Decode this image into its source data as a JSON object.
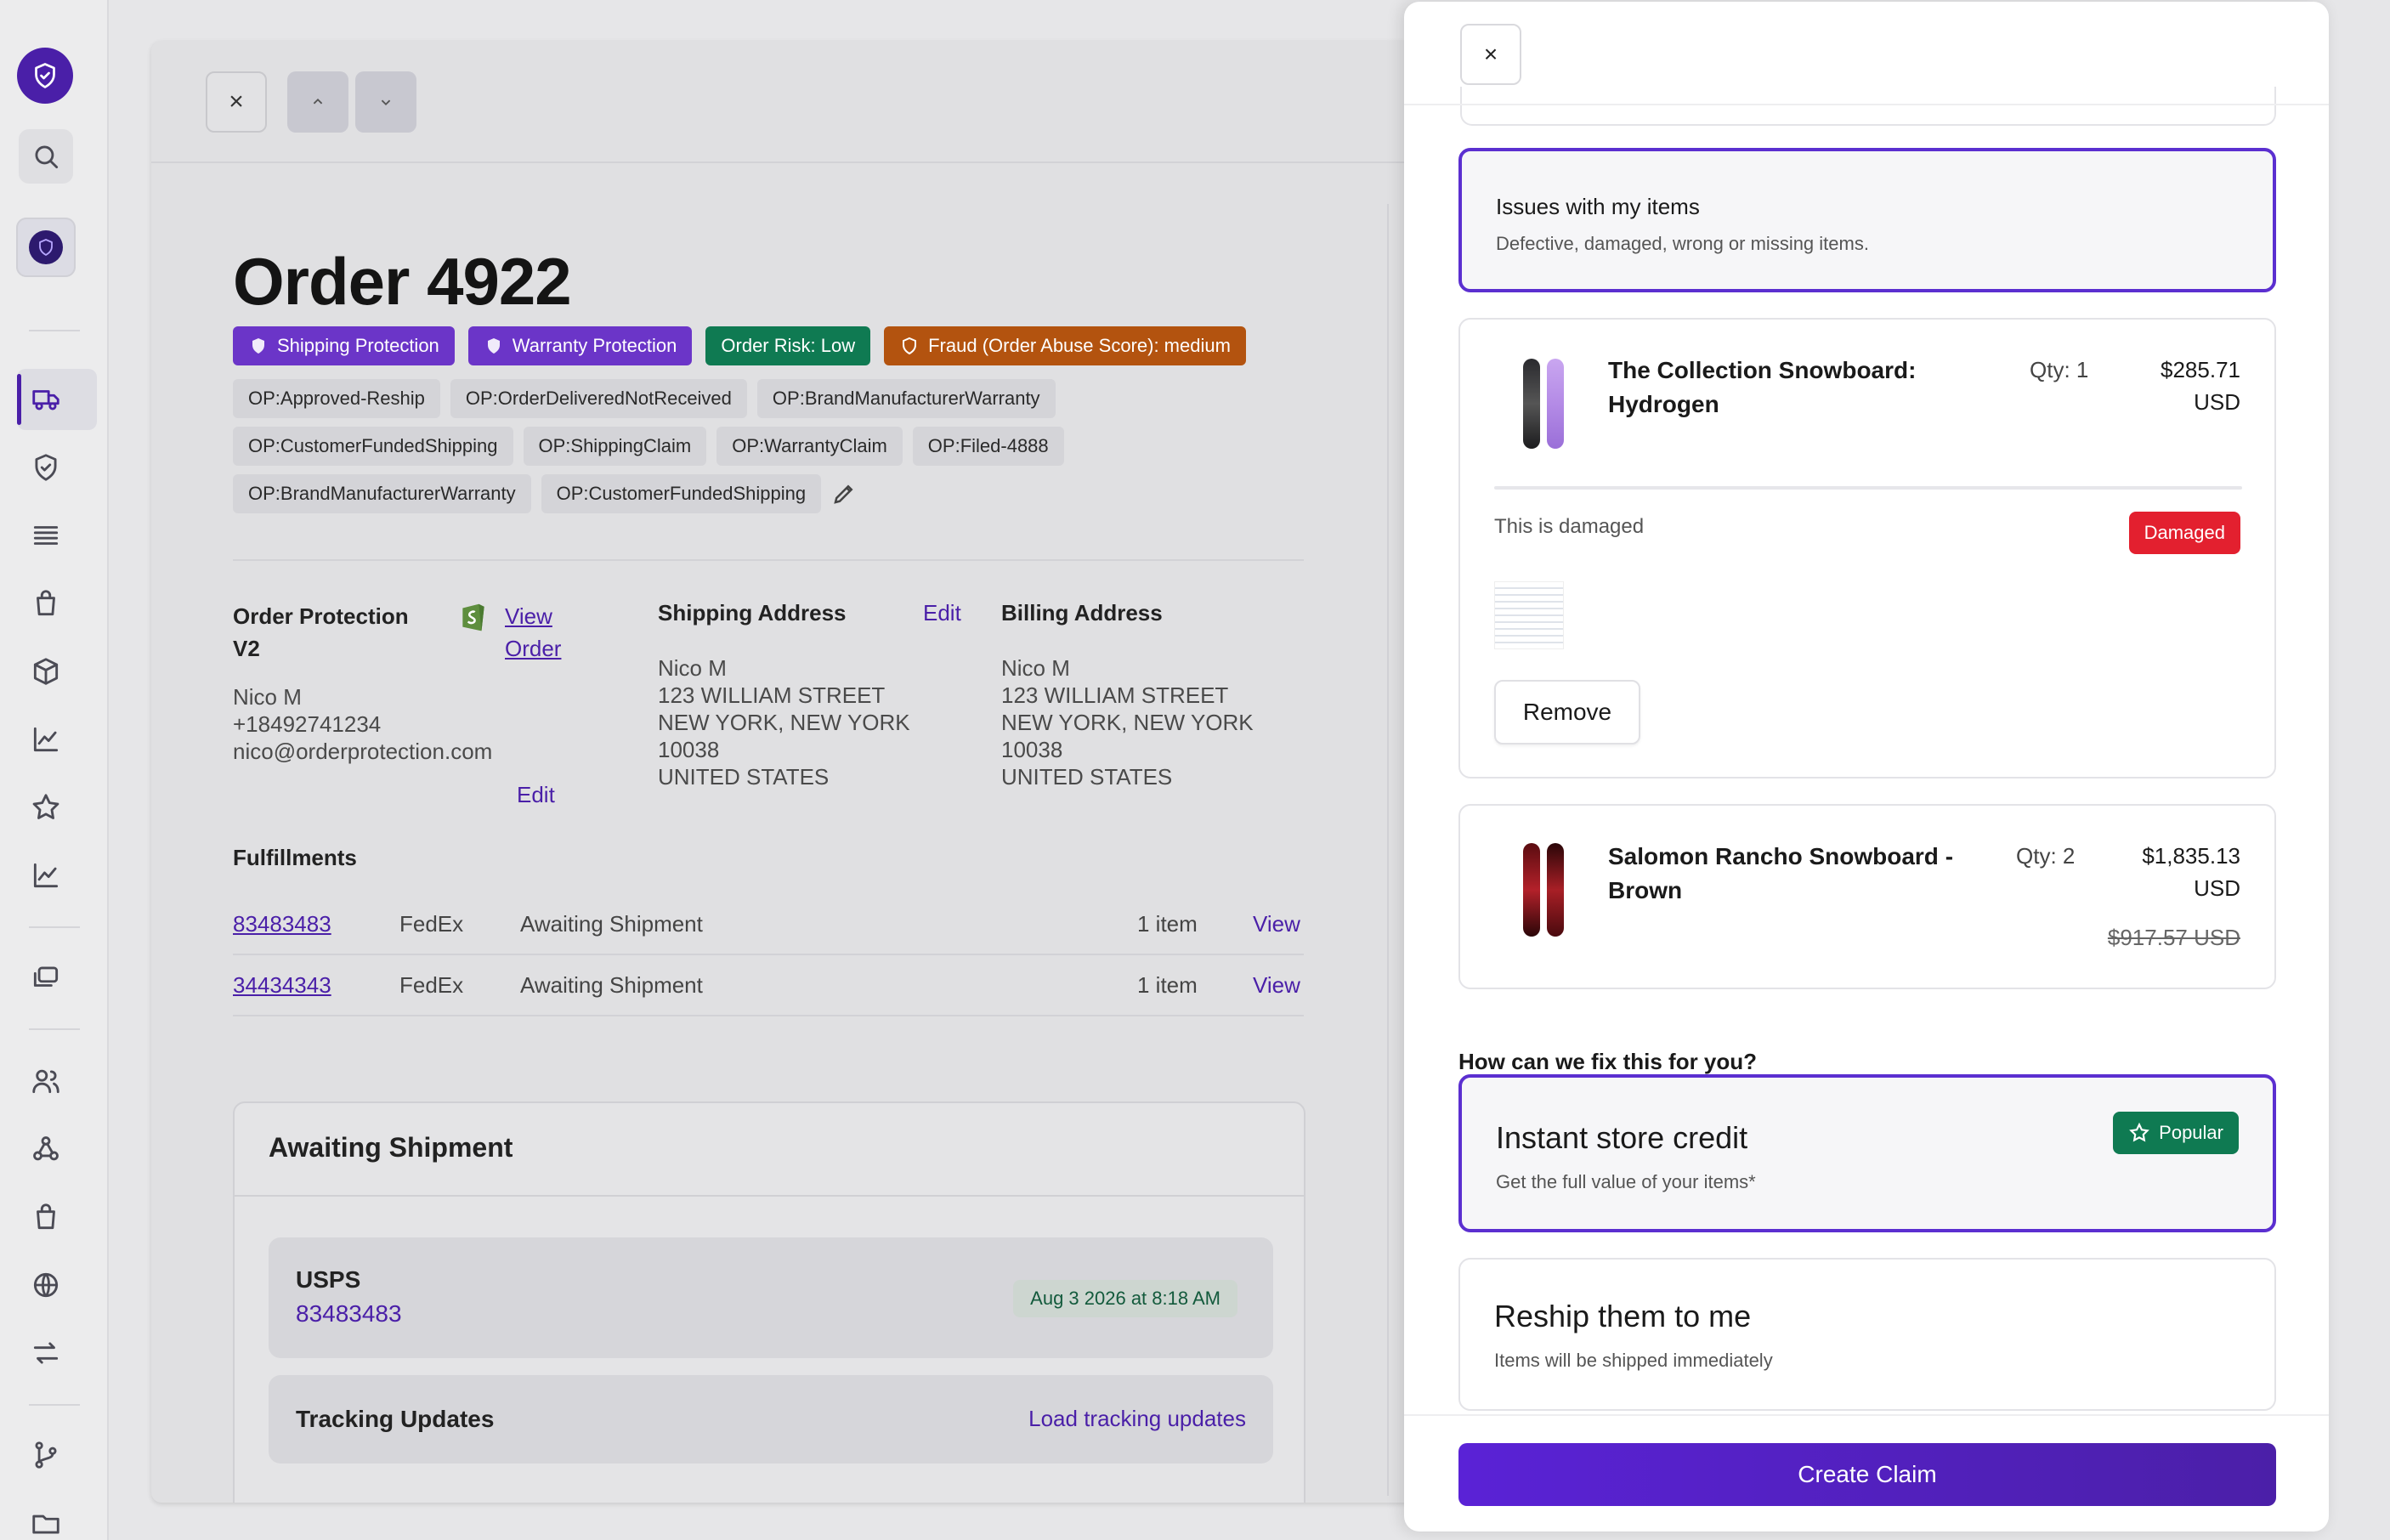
{
  "nav": {
    "icons": [
      "shield-logo-icon",
      "search-icon",
      "app-shield-icon",
      "truck-icon",
      "shield-icon",
      "list-icon",
      "bag-icon",
      "box-icon",
      "chart-icon",
      "star-icon",
      "chart-icon",
      "gallery-icon",
      "users-icon",
      "webhook-icon",
      "bag-icon",
      "globe-icon",
      "transfer-icon",
      "branch-icon",
      "folder-icon"
    ]
  },
  "order": {
    "title": "Order 4922",
    "badges": [
      {
        "label": "Shipping Protection",
        "color": "#6b35c8"
      },
      {
        "label": "Warranty Protection",
        "color": "#6b35c8"
      },
      {
        "label": "Order Risk: Low",
        "color": "#0f7a52"
      },
      {
        "label": "Fraud (Order Abuse Score): medium",
        "color": "#b3530f"
      }
    ],
    "tags": [
      "OP:Approved-Reship",
      "OP:OrderDeliveredNotReceived",
      "OP:BrandManufacturerWarranty",
      "OP:CustomerFundedShipping",
      "OP:ShippingClaim",
      "OP:WarrantyClaim",
      "OP:Filed-4888",
      "OP:BrandManufacturerWarranty",
      "OP:CustomerFundedShipping"
    ],
    "protection": {
      "title_line1": "Order Protection",
      "title_line2": "V2",
      "view_line1": "View",
      "view_line2": "Order",
      "name": "Nico M",
      "phone": "+18492741234",
      "email": "nico@orderprotection.com",
      "edit": "Edit"
    },
    "shipping": {
      "title": "Shipping Address",
      "edit": "Edit",
      "lines": [
        "Nico M",
        "123 WILLIAM STREET",
        "NEW YORK, NEW YORK",
        "10038",
        "UNITED STATES"
      ]
    },
    "billing": {
      "title": "Billing Address",
      "lines": [
        "Nico M",
        "123 WILLIAM STREET",
        "NEW YORK, NEW YORK",
        "10038",
        "UNITED STATES"
      ]
    },
    "fulfillments": {
      "title": "Fulfillments",
      "rows": [
        {
          "id": "83483483",
          "carrier": "FedEx",
          "status": "Awaiting Shipment",
          "count": "1 item",
          "action": "View"
        },
        {
          "id": "34434343",
          "carrier": "FedEx",
          "status": "Awaiting Shipment",
          "count": "1 item",
          "action": "View"
        }
      ]
    },
    "shipment": {
      "title": "Awaiting Shipment",
      "carrier": "USPS",
      "tracking": "83483483",
      "date": "Aug 3 2026 at 8:18 AM",
      "updates_title": "Tracking Updates",
      "load_link": "Load tracking updates"
    }
  },
  "drawer": {
    "close": "×",
    "issue": {
      "title": "Issues with my items",
      "subtitle": "Defective, damaged, wrong or missing items."
    },
    "items": [
      {
        "name": "The Collection Snowboard: Hydrogen",
        "qty": "Qty: 1",
        "price_line1": "$285.71",
        "price_line2": "USD",
        "note": "This is damaged",
        "reason": "Damaged",
        "remove": "Remove"
      },
      {
        "name": "Salomon Rancho Snowboard - Brown",
        "qty": "Qty: 2",
        "price_line1": "$1,835.13",
        "price_line2": "USD",
        "original_price": "$917.57 USD"
      }
    ],
    "fix_question": "How can we fix this for you?",
    "resolutions": [
      {
        "title": "Instant store credit",
        "subtitle": "Get the full value of your items*",
        "badge": "Popular"
      },
      {
        "title": "Reship them to me",
        "subtitle": "Items will be shipped immediately"
      }
    ],
    "create_button": "Create Claim"
  }
}
